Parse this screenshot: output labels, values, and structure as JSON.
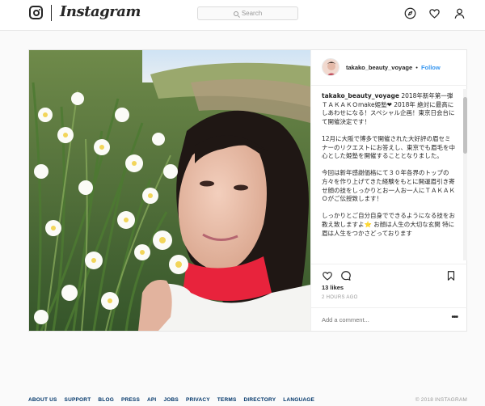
{
  "header": {
    "brand": "Instagram",
    "search_placeholder": "Search"
  },
  "post": {
    "username": "takako_beauty_voyage",
    "separator": "•",
    "follow_label": "Follow",
    "caption_lines": [
      "2018年新年第一弾ＴＡＫＡＫＯmake姫塾❤ 2018年 絶対に最高にしあわせになる！スペシャル企画！東京日会台にて開催決定です！",
      "12月に大阪で博多で開催された大好評の眉セミナーのリクエストにお答えし、東京でも眉毛を中心とした姫塾を開催することとなりました。",
      "今回は新年感謝価格にて３０年各界のトップの方々を作り上げてきた経験をもとに開運眉引き寄せ顔の技をしっかりとお一人お一人にＴＡＫＡＫＯがご伝授致します！",
      "しっかりとご自分自身でできるようになる技をお教え致しますよ⭐ お顔は人生の大切な玄関 特に眉は人生をつかさどっております"
    ],
    "likes": "13 likes",
    "timestamp": "2 HOURS AGO",
    "comment_placeholder": "Add a comment...",
    "more_label": "•••"
  },
  "footer": {
    "links": [
      "ABOUT US",
      "SUPPORT",
      "BLOG",
      "PRESS",
      "API",
      "JOBS",
      "PRIVACY",
      "TERMS",
      "DIRECTORY",
      "LANGUAGE"
    ],
    "copyright": "© 2018 INSTAGRAM"
  },
  "colors": {
    "link_blue": "#3897f0",
    "footer_link": "#003569",
    "sweater_red": "#e8233c"
  },
  "icons": [
    "instagram-glyph-icon",
    "search-icon",
    "compass-icon",
    "heart-icon",
    "profile-icon",
    "like-heart-icon",
    "comment-icon",
    "bookmark-icon",
    "more-options-icon"
  ]
}
